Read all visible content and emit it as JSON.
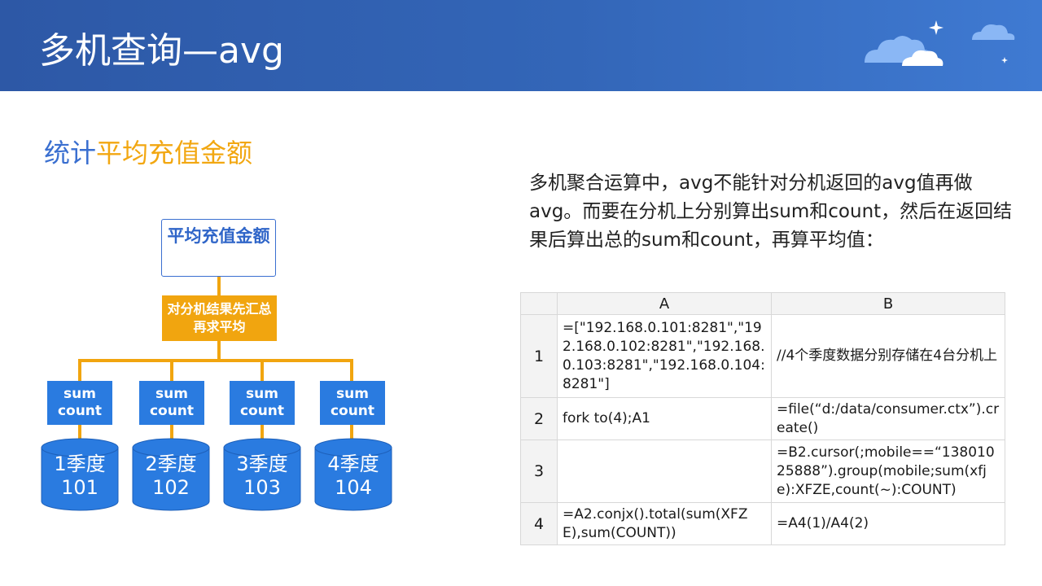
{
  "header": {
    "title": "多机查询—avg"
  },
  "subtitle": {
    "part1": "统计",
    "part2": "平均充值金额"
  },
  "description": "多机聚合运算中，avg不能针对分机返回的avg值再做avg。而要在分机上分别算出sum和count，然后在返回结果后算出总的sum和count，再算平均值：",
  "diagram": {
    "root": "平均充值金额",
    "middle": "对分机结果先汇总再求平均",
    "nodes": [
      {
        "sum": "sum",
        "count": "count",
        "quarter": "1季度",
        "id": "101"
      },
      {
        "sum": "sum",
        "count": "count",
        "quarter": "2季度",
        "id": "102"
      },
      {
        "sum": "sum",
        "count": "count",
        "quarter": "3季度",
        "id": "103"
      },
      {
        "sum": "sum",
        "count": "count",
        "quarter": "4季度",
        "id": "104"
      }
    ]
  },
  "grid": {
    "columns": [
      "A",
      "B"
    ],
    "rows": [
      {
        "num": "1",
        "a": "=[\"192.168.0.101:8281\",\"192.168.0.102:8281\",\"192.168.0.103:8281\",\"192.168.0.104:8281\"]",
        "b": "//4个季度数据分别存储在4台分机上"
      },
      {
        "num": "2",
        "a": "fork to(4);A1",
        "b": "=file(“d:/data/consumer.ctx”).create()"
      },
      {
        "num": "3",
        "a": "",
        "b": "=B2.cursor(;mobile==“13801025888”).group(mobile;sum(xfje):XFZE,count(~):COUNT)"
      },
      {
        "num": "4",
        "a": "=A2.conjx().total(sum(XFZE),sum(COUNT))",
        "b": "=A4(1)/A4(2)"
      }
    ]
  },
  "colors": {
    "header": "#3366b8",
    "accent_blue": "#3a6fd0",
    "accent_orange": "#f2a711",
    "node_blue": "#2a7be0"
  }
}
